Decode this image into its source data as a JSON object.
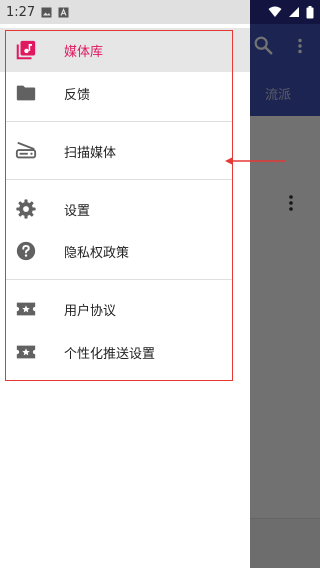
{
  "status_bar": {
    "time": "1:27",
    "icons": [
      "image-icon",
      "a-icon",
      "wifi-icon",
      "cellular-icon",
      "battery-icon"
    ]
  },
  "background_app": {
    "toolbar_color": "#3f51b5",
    "status_color": "#2a2d8f",
    "tab_label": "流派",
    "row_fragment": ")",
    "icons": [
      "search-icon",
      "overflow-menu-icon"
    ]
  },
  "drawer": {
    "items": [
      {
        "label": "媒体库",
        "icon": "media-library-icon",
        "selected": true
      },
      {
        "label": "反馈",
        "icon": "folder-icon",
        "selected": false
      },
      {
        "label": "扫描媒体",
        "icon": "scanner-icon",
        "selected": false
      },
      {
        "label": "设置",
        "icon": "gear-icon",
        "selected": false
      },
      {
        "label": "隐私权政策",
        "icon": "help-icon",
        "selected": false
      },
      {
        "label": "用户协议",
        "icon": "ticket-star-icon",
        "selected": false
      },
      {
        "label": "个性化推送设置",
        "icon": "ticket-star-icon",
        "selected": false
      }
    ]
  },
  "colors": {
    "selected_accent": "#e0185f",
    "annotation_red": "#e53935",
    "icon_grey": "#616161"
  }
}
